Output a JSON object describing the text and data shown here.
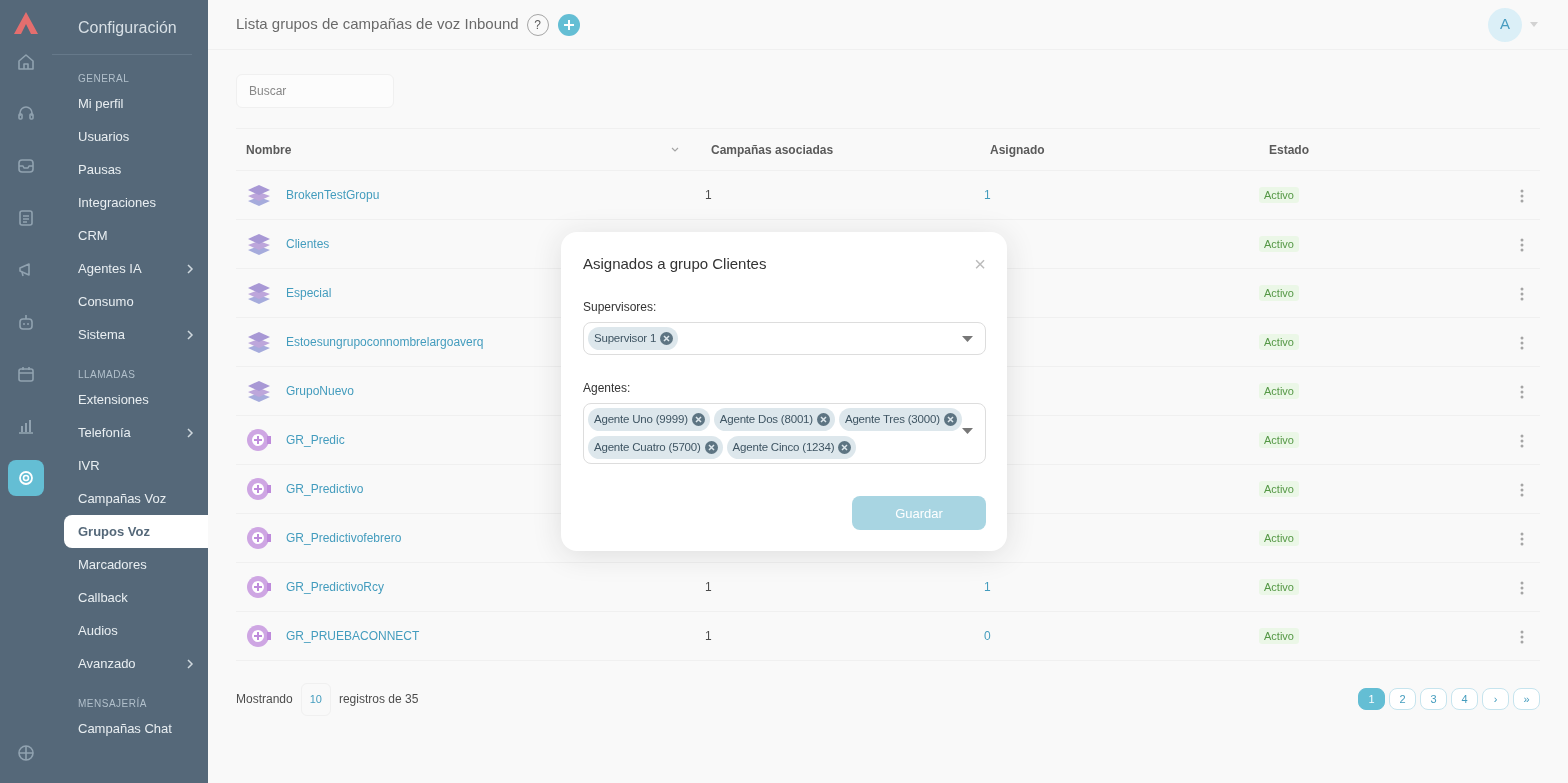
{
  "rail_icons": [
    {
      "kind": "home",
      "selected": false
    },
    {
      "kind": "headset",
      "selected": false
    },
    {
      "kind": "tray",
      "selected": false
    },
    {
      "kind": "document",
      "selected": false
    },
    {
      "kind": "megaphone",
      "selected": false
    },
    {
      "kind": "robot",
      "selected": false
    },
    {
      "kind": "calendar",
      "selected": false
    },
    {
      "kind": "chart",
      "selected": false
    },
    {
      "kind": "gear",
      "selected": true
    },
    {
      "kind": "globe",
      "selected": false
    }
  ],
  "sidebar": {
    "title": "Configuración",
    "items": [
      {
        "kind": "section",
        "label": "GENERAL"
      },
      {
        "kind": "item",
        "label": "Mi perfil",
        "selected": false,
        "submenu": false
      },
      {
        "kind": "item",
        "label": "Usuarios",
        "selected": false,
        "submenu": false
      },
      {
        "kind": "item",
        "label": "Pausas",
        "selected": false,
        "submenu": false
      },
      {
        "kind": "item",
        "label": "Integraciones",
        "selected": false,
        "submenu": false
      },
      {
        "kind": "item",
        "label": "CRM",
        "selected": false,
        "submenu": false
      },
      {
        "kind": "item",
        "label": "Agentes IA",
        "selected": false,
        "submenu": true
      },
      {
        "kind": "item",
        "label": "Consumo",
        "selected": false,
        "submenu": false
      },
      {
        "kind": "item",
        "label": "Sistema",
        "selected": false,
        "submenu": true
      },
      {
        "kind": "section",
        "label": "LLAMADAS"
      },
      {
        "kind": "item",
        "label": "Extensiones",
        "selected": false,
        "submenu": false
      },
      {
        "kind": "item",
        "label": "Telefonía",
        "selected": false,
        "submenu": true
      },
      {
        "kind": "item",
        "label": "IVR",
        "selected": false,
        "submenu": false
      },
      {
        "kind": "item",
        "label": "Campañas Voz",
        "selected": false,
        "submenu": false
      },
      {
        "kind": "item",
        "label": "Grupos Voz",
        "selected": true,
        "submenu": false
      },
      {
        "kind": "item",
        "label": "Marcadores",
        "selected": false,
        "submenu": false
      },
      {
        "kind": "item",
        "label": "Callback",
        "selected": false,
        "submenu": false
      },
      {
        "kind": "item",
        "label": "Audios",
        "selected": false,
        "submenu": false
      },
      {
        "kind": "item",
        "label": "Avanzado",
        "selected": false,
        "submenu": true
      },
      {
        "kind": "section",
        "label": "MENSAJERÍA"
      },
      {
        "kind": "item",
        "label": "Campañas Chat",
        "selected": false,
        "submenu": false
      }
    ]
  },
  "header": {
    "title": "Lista grupos de campañas de voz Inbound",
    "help": "?",
    "avatar": "A"
  },
  "search": {
    "placeholder": "Buscar"
  },
  "table": {
    "columns": [
      "Nombre",
      "Campañas asociadas",
      "Asignado",
      "Estado"
    ],
    "rows": [
      {
        "kind": "stack",
        "name": "BrokenTestGropu",
        "campaigns": "1",
        "assigned": "1",
        "status": "Activo"
      },
      {
        "kind": "stack",
        "name": "Clientes",
        "status": "Activo"
      },
      {
        "kind": "stack",
        "name": "Especial",
        "status": "Activo"
      },
      {
        "kind": "stack",
        "name": "Estoesungrupoconnombrelargoaverq",
        "status": "Activo"
      },
      {
        "kind": "stack",
        "name": "GrupoNuevo",
        "status": "Activo"
      },
      {
        "kind": "circle",
        "name": "GR_Predic",
        "status": "Activo"
      },
      {
        "kind": "circle",
        "name": "GR_Predictivo",
        "status": "Activo"
      },
      {
        "kind": "circle",
        "name": "GR_Predictivofebrero",
        "status": "Activo"
      },
      {
        "kind": "circle",
        "name": "GR_PredictivoRcy",
        "campaigns": "1",
        "assigned": "1",
        "status": "Activo"
      },
      {
        "kind": "circle",
        "name": "GR_PRUEBACONNECT",
        "campaigns": "1",
        "assigned": "0",
        "status": "Activo"
      }
    ]
  },
  "footer": {
    "showing": "Mostrando",
    "page_size": "10",
    "records": "registros de 35"
  },
  "pagination": [
    {
      "label": "1",
      "selected": true
    },
    {
      "label": "2",
      "selected": false
    },
    {
      "label": "3",
      "selected": false
    },
    {
      "label": "4",
      "selected": false
    },
    {
      "label": "›",
      "selected": false
    },
    {
      "label": "»",
      "selected": false
    }
  ],
  "modal": {
    "title": "Asignados a grupo Clientes",
    "close": "×",
    "supervisors": {
      "label": "Supervisores:",
      "chips": [
        "Supervisor 1"
      ]
    },
    "agents": {
      "label": "Agentes:",
      "chips": [
        "Agente Uno (9999)",
        "Agente Dos (8001)",
        "Agente Tres (3000)",
        "Agente Cuatro (5700)",
        "Agente Cinco (1234)"
      ]
    },
    "save": {
      "label": "Guardar",
      "disabled": true
    }
  }
}
